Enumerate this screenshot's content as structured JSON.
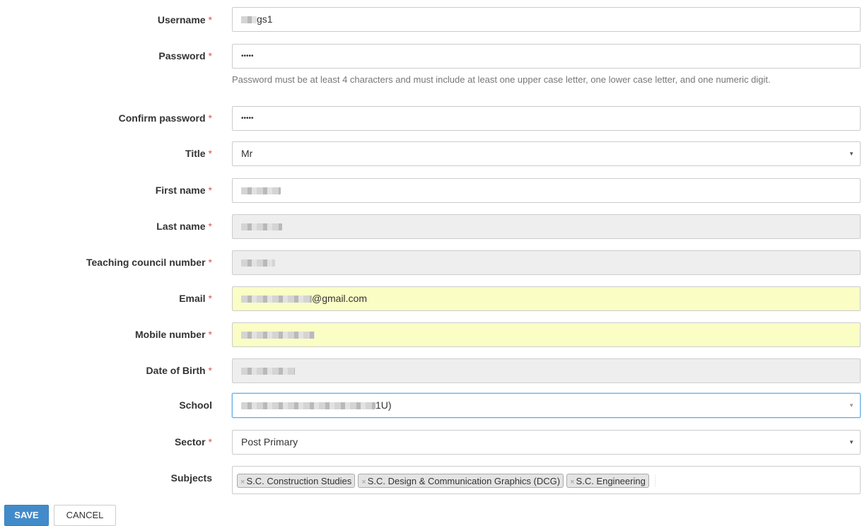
{
  "form": {
    "username": {
      "label": "Username",
      "required": "*",
      "value_suffix": "gs1"
    },
    "password": {
      "label": "Password",
      "required": "*",
      "value": "•••••",
      "help": "Password must be at least 4 characters and must include at least one upper case letter, one lower case letter, and one numeric digit."
    },
    "confirm_password": {
      "label": "Confirm password",
      "required": "*",
      "value": "•••••"
    },
    "title": {
      "label": "Title",
      "required": "*",
      "value": "Mr",
      "caret": "▼"
    },
    "first_name": {
      "label": "First name",
      "required": "*"
    },
    "last_name": {
      "label": "Last name",
      "required": "*"
    },
    "teaching_council_number": {
      "label": "Teaching council number",
      "required": "*"
    },
    "email": {
      "label": "Email",
      "required": "*",
      "value_suffix": "@gmail.com"
    },
    "mobile_number": {
      "label": "Mobile number",
      "required": "*"
    },
    "date_of_birth": {
      "label": "Date of Birth",
      "required": "*"
    },
    "school": {
      "label": "School",
      "value_suffix": "1U)",
      "caret": "▼"
    },
    "sector": {
      "label": "Sector",
      "required": "*",
      "value": "Post Primary",
      "caret": "▼"
    },
    "subjects": {
      "label": "Subjects",
      "remove_glyph": "×",
      "tags": [
        "S.C. Construction Studies",
        "S.C. Design & Communication Graphics (DCG)",
        "S.C. Engineering"
      ]
    }
  },
  "actions": {
    "save_label": "SAVE",
    "cancel_label": "CANCEL"
  },
  "colors": {
    "primary": "#428bca",
    "required": "#d9534f",
    "autofill": "#fafdc4",
    "readonly": "#eeeeee"
  }
}
